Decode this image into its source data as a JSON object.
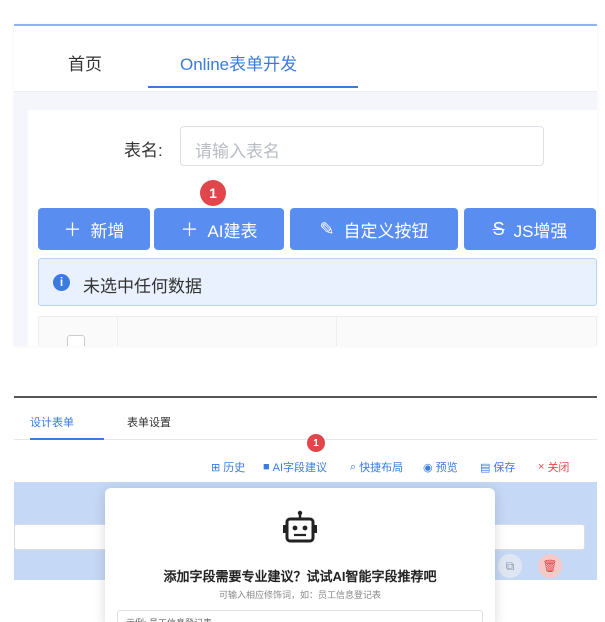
{
  "top": {
    "tabs": {
      "home": "首页",
      "online": "Online表单开发"
    },
    "search": {
      "label": "表名:",
      "placeholder": "请输入表名",
      "cut_label": "表"
    },
    "toolbar": {
      "add": "新增",
      "ai": "AI建表",
      "custom": "自定义按钮",
      "js": "JS增强",
      "badge": "1"
    },
    "alert": {
      "text": "未选中任何数据"
    }
  },
  "bottom": {
    "tabs": {
      "design": "设计表单",
      "settings": "表单设置"
    },
    "badge": "1",
    "actions": {
      "history": "历史",
      "ai": "AI字段建议",
      "layout": "快捷布局",
      "preview": "预览",
      "save": "保存",
      "close": "关闭"
    },
    "popover": {
      "title": "添加字段需要专业建议？试试AI智能字段推荐吧",
      "hint": "可输入相应修饰词，如：员工信息登记表",
      "input_value": "示例: 员工信息登记表"
    }
  },
  "colors": {
    "primary": "#5a8df0",
    "link": "#3a7be0",
    "danger": "#e0474b",
    "alert_bg": "#e8f1fd"
  },
  "icons": [
    "plus-icon",
    "pen-icon",
    "strike-icon",
    "info-icon",
    "history-icon",
    "robot-icon",
    "layout-icon",
    "eye-icon",
    "save-icon",
    "close-icon",
    "copy-icon",
    "delete-icon"
  ]
}
